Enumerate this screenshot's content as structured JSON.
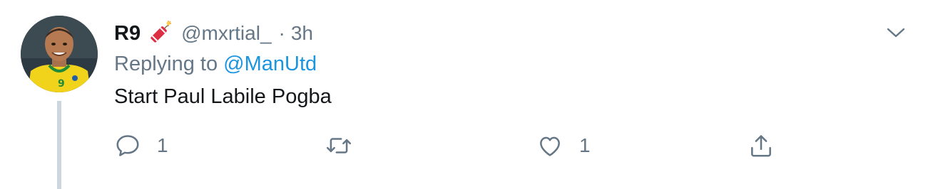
{
  "tweet": {
    "display_name": "R9",
    "handle": "@mxrtial_",
    "separator": "·",
    "time": "3h",
    "replying_prefix": "Replying to",
    "replying_to": "@ManUtd",
    "text": "Start Paul Labile Pogba"
  },
  "actions": {
    "reply_count": "1",
    "retweet_count": "",
    "like_count": "1"
  },
  "icons": {
    "name_emoji": "firecracker-emoji",
    "caret": "chevron-down-icon",
    "reply": "reply-icon",
    "retweet": "retweet-icon",
    "like": "heart-icon",
    "share": "share-icon"
  },
  "colors": {
    "text": "#14171a",
    "secondary": "#657786",
    "link": "#1b95e0",
    "thread_line": "#ccd6dd"
  }
}
